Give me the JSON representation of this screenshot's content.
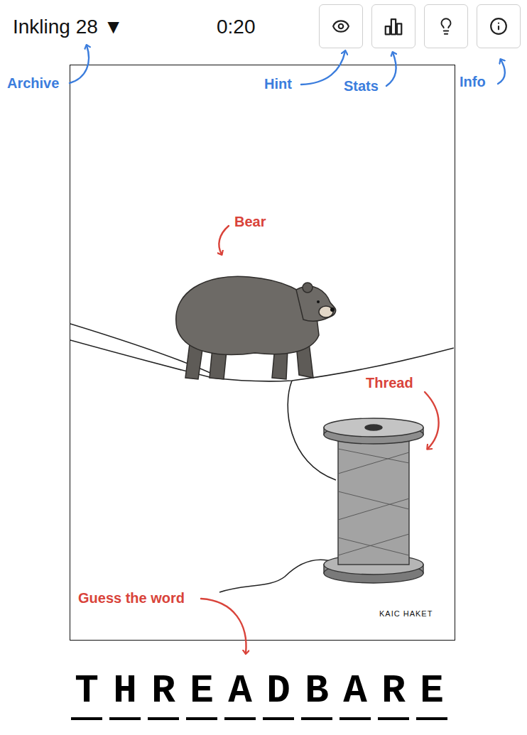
{
  "header": {
    "title": "Inkling 28 ▼",
    "timer": "0:20"
  },
  "annotations": [
    {
      "label": "Archive",
      "color": "#3b7ddd"
    },
    {
      "label": "Hint",
      "color": "#3b7ddd"
    },
    {
      "label": "Stats",
      "color": "#3b7ddd"
    },
    {
      "label": "Info",
      "color": "#3b7ddd"
    },
    {
      "label": "Bear",
      "color": "#d9433a"
    },
    {
      "label": "Thread",
      "color": "#d9433a"
    },
    {
      "label": "Guess the word",
      "color": "#d9433a"
    }
  ],
  "cartoon": {
    "signature": "KAIC HAKET"
  },
  "answer": {
    "letters": [
      "T",
      "H",
      "R",
      "E",
      "A",
      "D",
      "B",
      "A",
      "R",
      "E"
    ]
  }
}
